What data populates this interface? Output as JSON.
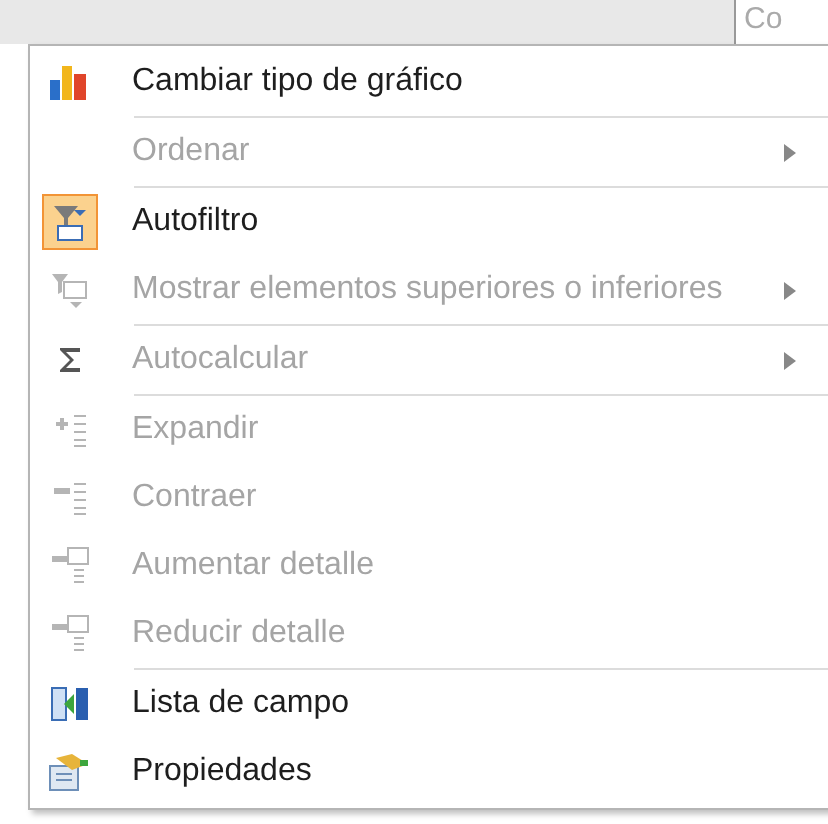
{
  "background": {
    "cell_text": "Co"
  },
  "menu": {
    "items": [
      {
        "kind": "chart",
        "label": "Cambiar tipo de gráfico",
        "disabled": false,
        "submenu": false,
        "checked": false,
        "separator_after": true
      },
      {
        "kind": "none",
        "label": "Ordenar",
        "disabled": true,
        "submenu": true,
        "checked": false,
        "separator_after": true
      },
      {
        "kind": "filter",
        "label": "Autofiltro",
        "disabled": false,
        "submenu": false,
        "checked": true,
        "separator_after": false
      },
      {
        "kind": "top10",
        "label": "Mostrar elementos superiores o inferiores",
        "disabled": true,
        "submenu": true,
        "checked": false,
        "separator_after": true
      },
      {
        "kind": "sigma",
        "label": "Autocalcular",
        "disabled": true,
        "submenu": true,
        "checked": false,
        "separator_after": true
      },
      {
        "kind": "expand",
        "label": "Expandir",
        "disabled": true,
        "submenu": false,
        "checked": false,
        "separator_after": false
      },
      {
        "kind": "collapse",
        "label": "Contraer",
        "disabled": true,
        "submenu": false,
        "checked": false,
        "separator_after": false
      },
      {
        "kind": "drillup",
        "label": "Aumentar detalle",
        "disabled": true,
        "submenu": false,
        "checked": false,
        "separator_after": false
      },
      {
        "kind": "drilldown",
        "label": "Reducir detalle",
        "disabled": true,
        "submenu": false,
        "checked": false,
        "separator_after": true
      },
      {
        "kind": "fieldlist",
        "label": "Lista de campo",
        "disabled": false,
        "submenu": false,
        "checked": false,
        "separator_after": false
      },
      {
        "kind": "properties",
        "label": "Propiedades",
        "disabled": false,
        "submenu": false,
        "checked": false,
        "separator_after": false
      }
    ]
  }
}
